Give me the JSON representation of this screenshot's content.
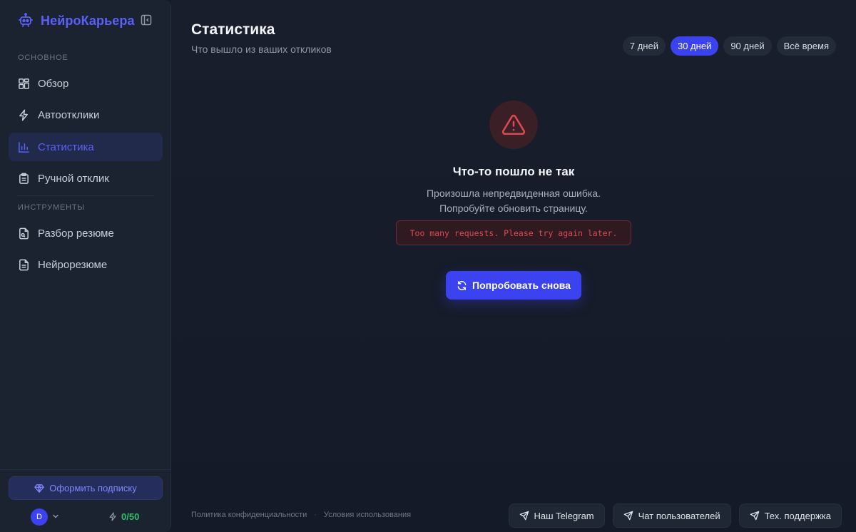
{
  "brand": {
    "name": "НейроКарьера",
    "accent": "#5b61f6"
  },
  "sidebar": {
    "sections": [
      {
        "label": "ОСНОВНОЕ"
      },
      {
        "label": "ИНСТРУМЕНТЫ"
      }
    ],
    "items": [
      {
        "label": "Обзор",
        "icon": "grid-icon",
        "active": false
      },
      {
        "label": "Автоотклики",
        "icon": "lightning-icon",
        "active": false
      },
      {
        "label": "Статистика",
        "icon": "bar-chart-icon",
        "active": true
      },
      {
        "label": "Ручной отклик",
        "icon": "clipboard-icon",
        "active": false
      },
      {
        "label": "Разбор резюме",
        "icon": "file-search-icon",
        "active": false
      },
      {
        "label": "Нейрорезюме",
        "icon": "file-text-icon",
        "active": false
      }
    ],
    "subscribe_label": "Оформить подписку",
    "user_initial": "D",
    "credits": "0/50"
  },
  "header": {
    "title": "Статистика",
    "subtitle": "Что вышло из ваших откликов",
    "periods": [
      {
        "label": "7 дней",
        "active": false
      },
      {
        "label": "30 дней",
        "active": true
      },
      {
        "label": "90 дней",
        "active": false
      },
      {
        "label": "Всё время",
        "active": false
      }
    ]
  },
  "error": {
    "title": "Что-то пошло не так",
    "line1": "Произошла непредвиденная ошибка.",
    "line2": "Попробуйте обновить страницу.",
    "code": "Too many requests. Please try again later.",
    "retry_label": "Попробовать снова",
    "color": "#e0484f"
  },
  "footer": {
    "privacy": "Политика конфиденциальности",
    "separator": "·",
    "terms": "Условия использования",
    "buttons": [
      {
        "label": "Наш Telegram",
        "icon": "send-icon"
      },
      {
        "label": "Чат пользователей",
        "icon": "send-icon"
      },
      {
        "label": "Тех. поддержка",
        "icon": "send-icon"
      }
    ]
  }
}
